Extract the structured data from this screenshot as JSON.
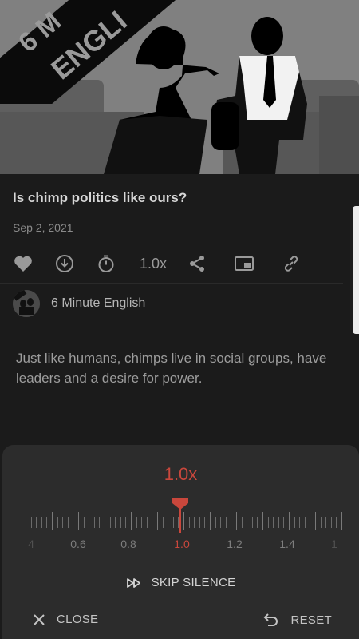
{
  "artwork": {
    "label_line1": "6 M",
    "label_line2": "ENGLI"
  },
  "episode": {
    "title": "Is chimp politics like ours?",
    "date": "Sep 2, 2021",
    "description": "Just like humans, chimps live in social groups, have leaders and a desire for power."
  },
  "actions": {
    "icons": [
      "heart-icon",
      "download-icon",
      "timer-icon",
      "share-icon",
      "picture-in-picture-icon",
      "link-icon"
    ],
    "speed_label": "1.0x"
  },
  "source": {
    "name": "6 Minute English"
  },
  "speed_sheet": {
    "current_speed": "1.0x",
    "tick_labels": [
      "4",
      "0.6",
      "0.8",
      "1.0",
      "1.2",
      "1.4",
      "1"
    ],
    "active_value": 1.0,
    "skip_silence_label": "SKIP SILENCE",
    "close_label": "CLOSE",
    "reset_label": "RESET"
  },
  "colors": {
    "accent": "#c9473c",
    "background": "#1b1b1b",
    "sheet": "#2c2c2c"
  }
}
